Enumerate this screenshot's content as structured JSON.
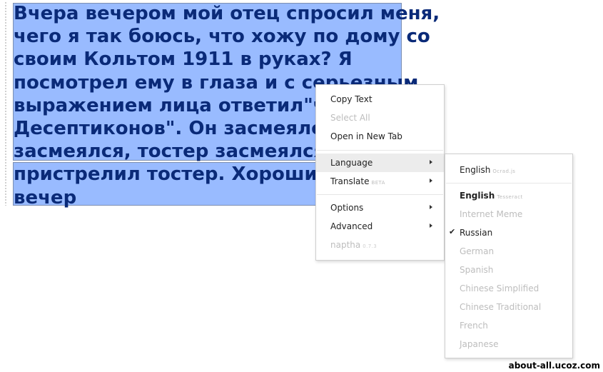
{
  "selected_text": {
    "lines": [
      "Вчера вечером мой отец спросил меня,",
      "чего я так боюсь, что хожу по дому со",
      "своим Кольтом 1911 в руках? Я",
      "посмотрел ему в глаза и с серьезным",
      "выражением лица ответил\"чер",
      "Десептиконов\". Он засмеялся,",
      "засмеялся, тостер засмеялся и",
      "пристрелил тостер. Хороший б",
      "вечер"
    ]
  },
  "context_menu": {
    "items": [
      {
        "label": "Copy Text",
        "enabled": true
      },
      {
        "label": "Select All",
        "enabled": false
      },
      {
        "label": "Open in New Tab",
        "enabled": true
      },
      {
        "label": "Language",
        "enabled": true,
        "submenu": true,
        "highlighted": true
      },
      {
        "label": "Translate",
        "badge": "BETA",
        "enabled": true,
        "submenu": true
      },
      {
        "label": "Options",
        "enabled": true,
        "submenu": true
      },
      {
        "label": "Advanced",
        "enabled": true,
        "submenu": true
      },
      {
        "label": "naptha",
        "badge": "0.7.3",
        "enabled": false
      }
    ]
  },
  "language_menu": {
    "items": [
      {
        "label": "English",
        "engine": "Ocrad.js",
        "enabled": true
      },
      {
        "label": "English",
        "engine": "Tesseract",
        "enabled": true,
        "bold": true
      },
      {
        "label": "Internet Meme",
        "enabled": false
      },
      {
        "label": "Russian",
        "enabled": true,
        "checked": true
      },
      {
        "label": "German",
        "enabled": false
      },
      {
        "label": "Spanish",
        "enabled": false
      },
      {
        "label": "Chinese Simplified",
        "enabled": false
      },
      {
        "label": "Chinese Traditional",
        "enabled": false
      },
      {
        "label": "French",
        "enabled": false
      },
      {
        "label": "Japanese",
        "enabled": false
      }
    ]
  },
  "watermark": "about-all.ucoz.com",
  "colors": {
    "selection": "#99bbff",
    "selected_text": "#0a2a78",
    "menu_hover": "#ececec",
    "disabled_text": "#bdbdbd"
  },
  "icons": {
    "submenu_arrow": "chevron-right-icon",
    "check": "checkmark-icon"
  }
}
